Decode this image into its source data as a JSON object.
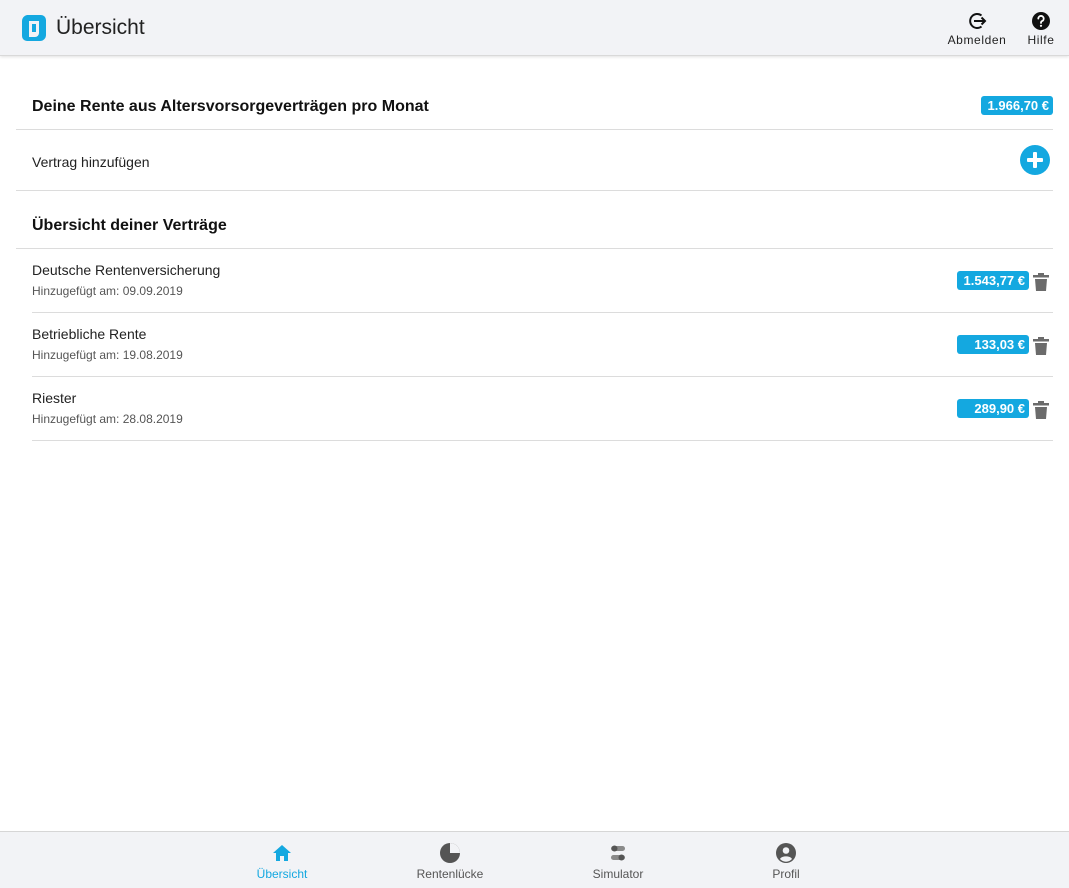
{
  "header": {
    "title": "Übersicht",
    "logout_label": "Abmelden",
    "help_label": "Hilfe",
    "accent": "#14a8e0"
  },
  "summary": {
    "title": "Deine Rente aus Altersvorsorgeverträgen pro Monat",
    "total": "1.966,70 €"
  },
  "add_contract": {
    "label": "Vertrag hinzufügen"
  },
  "contracts_section": {
    "title": "Übersicht deiner Verträge",
    "items": [
      {
        "name": "Deutsche Rentenversicherung",
        "added": "Hinzugefügt am: 09.09.2019",
        "amount": "1.543,77 €"
      },
      {
        "name": "Betriebliche Rente",
        "added": "Hinzugefügt am: 19.08.2019",
        "amount": "133,03 €"
      },
      {
        "name": "Riester",
        "added": "Hinzugefügt am: 28.08.2019",
        "amount": "289,90 €"
      }
    ]
  },
  "bottom_nav": {
    "items": [
      {
        "label": "Übersicht",
        "icon": "home-icon",
        "active": true
      },
      {
        "label": "Rentenlücke",
        "icon": "pie-chart-icon",
        "active": false
      },
      {
        "label": "Simulator",
        "icon": "toggles-icon",
        "active": false
      },
      {
        "label": "Profil",
        "icon": "account-circle-icon",
        "active": false
      }
    ]
  }
}
